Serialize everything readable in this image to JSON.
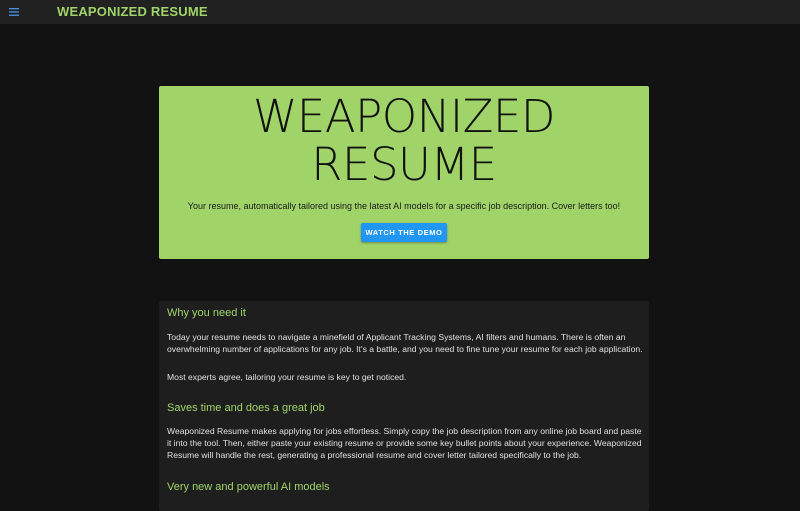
{
  "appbar": {
    "menu_icon": "hamburger-menu-icon",
    "title": "WEAPONIZED RESUME"
  },
  "hero": {
    "title_line1": "WEAPONIZED",
    "title_line2": "RESUME",
    "subtitle": "Your resume, automatically tailored using the latest AI models for a specific job description. Cover letters too!",
    "button_label": "WATCH THE DEMO"
  },
  "sections": [
    {
      "heading": "Why you need it",
      "paragraphs": [
        "Today your resume needs to navigate a minefield of Applicant Tracking Systems, AI filters and humans. There is often an overwhelming number of applications for any job. It's a battle, and you need to fine tune your resume for each job application.",
        "Most experts agree, tailoring your resume is key to get noticed."
      ]
    },
    {
      "heading": "Saves time and does a great job",
      "paragraphs": [
        "Weaponized Resume makes applying for jobs effortless. Simply copy the job description from any online job board and paste it into the tool. Then, either paste your existing resume or provide some key bullet points about your experience. Weaponized Resume will handle the rest, generating a professional resume and cover letter tailored specifically to the job."
      ]
    },
    {
      "heading": "Very new and powerful AI models",
      "paragraphs": []
    }
  ],
  "colors": {
    "accent_green": "#a0d468",
    "button_blue": "#2196f3",
    "background": "#121212",
    "appbar": "#212121",
    "card": "#1e1e1e"
  }
}
